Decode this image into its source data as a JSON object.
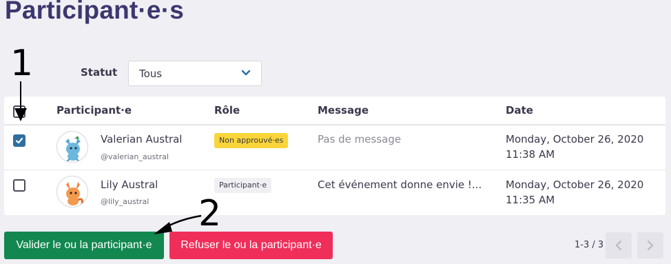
{
  "page": {
    "title": "Participant·e·s"
  },
  "filter": {
    "label": "Statut",
    "selected": "Tous"
  },
  "table": {
    "headers": {
      "participant": "Participant·e",
      "role": "Rôle",
      "message": "Message",
      "date": "Date"
    },
    "rows": [
      {
        "checked": true,
        "name": "Valerian Austral",
        "handle": "@valerian_austral",
        "role": "Non approuvé·es",
        "role_style": "warning",
        "message": "Pas de message",
        "date_line1": "Monday, October 26, 2020",
        "date_line2": "11:38 AM"
      },
      {
        "checked": false,
        "name": "Lily Austral",
        "handle": "@lily_austral",
        "role": "Participant·e",
        "role_style": "plain",
        "message": "Cet événement donne envie !...",
        "date_line1": "Monday, October 26, 2020",
        "date_line2": "11:35 AM"
      }
    ]
  },
  "actions": {
    "approve_label": "Valider le ou la participant·e",
    "reject_label": "Refuser le ou la participant·e"
  },
  "pagination": {
    "text": "1-3 / 3"
  },
  "annotations": {
    "step1": "1",
    "step2": "2"
  },
  "colors": {
    "title": "#3c376e",
    "approve": "#128750",
    "reject": "#f02e5a",
    "badge_warning": "#fad53a",
    "checkbox_checked": "#2f6fa0"
  }
}
